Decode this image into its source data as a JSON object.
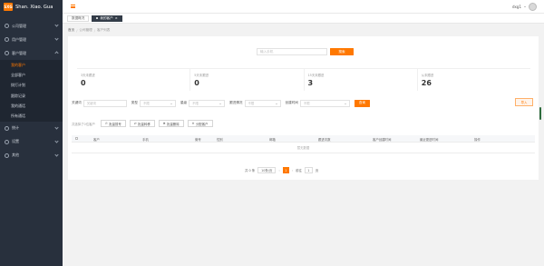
{
  "logo": {
    "mark": "SXG",
    "text": "Shan. Xiao. Gua"
  },
  "sidebar": {
    "items": [
      {
        "label": "公司管理",
        "icon": "building-icon"
      },
      {
        "label": "用户管理",
        "icon": "user-icon"
      },
      {
        "label": "客户管理",
        "icon": "customer-icon"
      }
    ],
    "sub_items": [
      {
        "label": "我的客户",
        "active": true
      },
      {
        "label": "全部客户",
        "active": false
      },
      {
        "label": "拨打计划",
        "active": false
      },
      {
        "label": "跟踪记录",
        "active": false
      },
      {
        "label": "我的通话",
        "active": false
      },
      {
        "label": "所有通话",
        "active": false
      }
    ],
    "bottom_items": [
      {
        "label": "统计",
        "icon": "chart-icon"
      },
      {
        "label": "设置",
        "icon": "gear-icon"
      },
      {
        "label": "其他",
        "icon": "more-icon"
      }
    ]
  },
  "header": {
    "user_name": "dxg1"
  },
  "tags": {
    "home": "数据概况",
    "active": "我的客户",
    "close": "×"
  },
  "breadcrumb": {
    "home": "首页",
    "level1": "公司管理",
    "level2": "客户列表",
    "sep": "/"
  },
  "search": {
    "placeholder": "输入手机",
    "button": "搜索"
  },
  "stats": [
    {
      "label": "3天未跟进",
      "value": "0"
    },
    {
      "label": "5天未跟进",
      "value": "0"
    },
    {
      "label": "15天未跟进",
      "value": "3"
    },
    {
      "label": "从未跟进",
      "value": "26"
    }
  ],
  "filters": {
    "keyword_label": "关键词",
    "keyword_placeholder": "关键词",
    "status_label": "类型",
    "status_value": "不限",
    "level_label": "星级",
    "level_value": "不限",
    "follow_label": "跟进情况",
    "follow_value": "不限",
    "time_label": "创建时间",
    "time_value": "不限",
    "search_button": "查询"
  },
  "import_button": "导入",
  "actions": {
    "selected_text": "共选择了0位客户",
    "buttons": [
      {
        "label": "批量拨号",
        "icon": "phone-icon"
      },
      {
        "label": "批量转移",
        "icon": "transfer-icon"
      },
      {
        "label": "批量删除",
        "icon": "delete-icon"
      },
      {
        "label": "分配客户",
        "icon": "assign-icon"
      }
    ]
  },
  "table": {
    "columns": [
      "客户",
      "手机",
      "微号",
      "性别",
      "邮箱",
      "跟进次数",
      "客户创建时间",
      "最近更进时间",
      "操作"
    ],
    "empty_text": "暂无数据"
  },
  "pager": {
    "total": "共 0 条",
    "page_size": "10条/页",
    "prev": "‹",
    "next": "›",
    "current": "1",
    "goto_label": "前往",
    "goto_value": "1",
    "page_unit": "页"
  },
  "colors": {
    "accent": "#ff7800",
    "sidebar_bg": "#28303d",
    "submenu_bg": "#1f2631"
  }
}
